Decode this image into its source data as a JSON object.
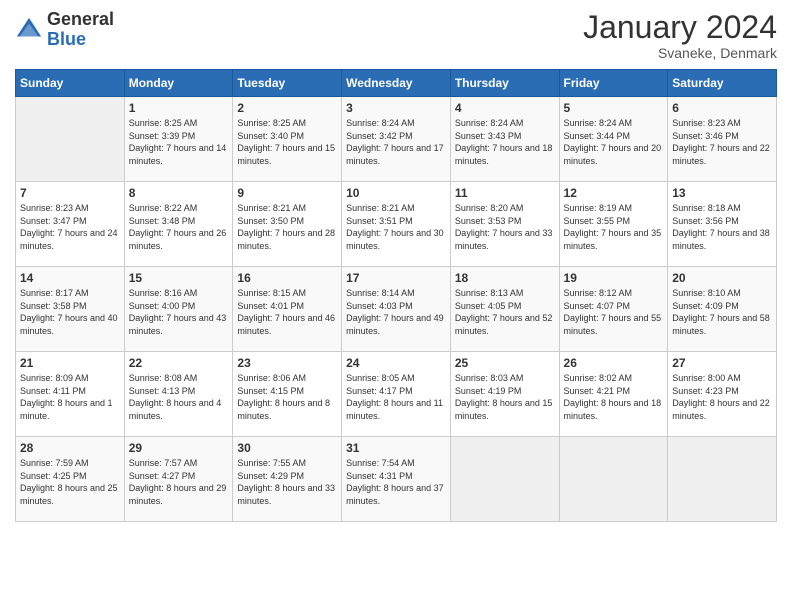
{
  "header": {
    "logo_general": "General",
    "logo_blue": "Blue",
    "month_title": "January 2024",
    "subtitle": "Svaneke, Denmark"
  },
  "days_of_week": [
    "Sunday",
    "Monday",
    "Tuesday",
    "Wednesday",
    "Thursday",
    "Friday",
    "Saturday"
  ],
  "weeks": [
    [
      {
        "day": "",
        "sunrise": "",
        "sunset": "",
        "daylight": ""
      },
      {
        "day": "1",
        "sunrise": "Sunrise: 8:25 AM",
        "sunset": "Sunset: 3:39 PM",
        "daylight": "Daylight: 7 hours and 14 minutes."
      },
      {
        "day": "2",
        "sunrise": "Sunrise: 8:25 AM",
        "sunset": "Sunset: 3:40 PM",
        "daylight": "Daylight: 7 hours and 15 minutes."
      },
      {
        "day": "3",
        "sunrise": "Sunrise: 8:24 AM",
        "sunset": "Sunset: 3:42 PM",
        "daylight": "Daylight: 7 hours and 17 minutes."
      },
      {
        "day": "4",
        "sunrise": "Sunrise: 8:24 AM",
        "sunset": "Sunset: 3:43 PM",
        "daylight": "Daylight: 7 hours and 18 minutes."
      },
      {
        "day": "5",
        "sunrise": "Sunrise: 8:24 AM",
        "sunset": "Sunset: 3:44 PM",
        "daylight": "Daylight: 7 hours and 20 minutes."
      },
      {
        "day": "6",
        "sunrise": "Sunrise: 8:23 AM",
        "sunset": "Sunset: 3:46 PM",
        "daylight": "Daylight: 7 hours and 22 minutes."
      }
    ],
    [
      {
        "day": "7",
        "sunrise": "Sunrise: 8:23 AM",
        "sunset": "Sunset: 3:47 PM",
        "daylight": "Daylight: 7 hours and 24 minutes."
      },
      {
        "day": "8",
        "sunrise": "Sunrise: 8:22 AM",
        "sunset": "Sunset: 3:48 PM",
        "daylight": "Daylight: 7 hours and 26 minutes."
      },
      {
        "day": "9",
        "sunrise": "Sunrise: 8:21 AM",
        "sunset": "Sunset: 3:50 PM",
        "daylight": "Daylight: 7 hours and 28 minutes."
      },
      {
        "day": "10",
        "sunrise": "Sunrise: 8:21 AM",
        "sunset": "Sunset: 3:51 PM",
        "daylight": "Daylight: 7 hours and 30 minutes."
      },
      {
        "day": "11",
        "sunrise": "Sunrise: 8:20 AM",
        "sunset": "Sunset: 3:53 PM",
        "daylight": "Daylight: 7 hours and 33 minutes."
      },
      {
        "day": "12",
        "sunrise": "Sunrise: 8:19 AM",
        "sunset": "Sunset: 3:55 PM",
        "daylight": "Daylight: 7 hours and 35 minutes."
      },
      {
        "day": "13",
        "sunrise": "Sunrise: 8:18 AM",
        "sunset": "Sunset: 3:56 PM",
        "daylight": "Daylight: 7 hours and 38 minutes."
      }
    ],
    [
      {
        "day": "14",
        "sunrise": "Sunrise: 8:17 AM",
        "sunset": "Sunset: 3:58 PM",
        "daylight": "Daylight: 7 hours and 40 minutes."
      },
      {
        "day": "15",
        "sunrise": "Sunrise: 8:16 AM",
        "sunset": "Sunset: 4:00 PM",
        "daylight": "Daylight: 7 hours and 43 minutes."
      },
      {
        "day": "16",
        "sunrise": "Sunrise: 8:15 AM",
        "sunset": "Sunset: 4:01 PM",
        "daylight": "Daylight: 7 hours and 46 minutes."
      },
      {
        "day": "17",
        "sunrise": "Sunrise: 8:14 AM",
        "sunset": "Sunset: 4:03 PM",
        "daylight": "Daylight: 7 hours and 49 minutes."
      },
      {
        "day": "18",
        "sunrise": "Sunrise: 8:13 AM",
        "sunset": "Sunset: 4:05 PM",
        "daylight": "Daylight: 7 hours and 52 minutes."
      },
      {
        "day": "19",
        "sunrise": "Sunrise: 8:12 AM",
        "sunset": "Sunset: 4:07 PM",
        "daylight": "Daylight: 7 hours and 55 minutes."
      },
      {
        "day": "20",
        "sunrise": "Sunrise: 8:10 AM",
        "sunset": "Sunset: 4:09 PM",
        "daylight": "Daylight: 7 hours and 58 minutes."
      }
    ],
    [
      {
        "day": "21",
        "sunrise": "Sunrise: 8:09 AM",
        "sunset": "Sunset: 4:11 PM",
        "daylight": "Daylight: 8 hours and 1 minute."
      },
      {
        "day": "22",
        "sunrise": "Sunrise: 8:08 AM",
        "sunset": "Sunset: 4:13 PM",
        "daylight": "Daylight: 8 hours and 4 minutes."
      },
      {
        "day": "23",
        "sunrise": "Sunrise: 8:06 AM",
        "sunset": "Sunset: 4:15 PM",
        "daylight": "Daylight: 8 hours and 8 minutes."
      },
      {
        "day": "24",
        "sunrise": "Sunrise: 8:05 AM",
        "sunset": "Sunset: 4:17 PM",
        "daylight": "Daylight: 8 hours and 11 minutes."
      },
      {
        "day": "25",
        "sunrise": "Sunrise: 8:03 AM",
        "sunset": "Sunset: 4:19 PM",
        "daylight": "Daylight: 8 hours and 15 minutes."
      },
      {
        "day": "26",
        "sunrise": "Sunrise: 8:02 AM",
        "sunset": "Sunset: 4:21 PM",
        "daylight": "Daylight: 8 hours and 18 minutes."
      },
      {
        "day": "27",
        "sunrise": "Sunrise: 8:00 AM",
        "sunset": "Sunset: 4:23 PM",
        "daylight": "Daylight: 8 hours and 22 minutes."
      }
    ],
    [
      {
        "day": "28",
        "sunrise": "Sunrise: 7:59 AM",
        "sunset": "Sunset: 4:25 PM",
        "daylight": "Daylight: 8 hours and 25 minutes."
      },
      {
        "day": "29",
        "sunrise": "Sunrise: 7:57 AM",
        "sunset": "Sunset: 4:27 PM",
        "daylight": "Daylight: 8 hours and 29 minutes."
      },
      {
        "day": "30",
        "sunrise": "Sunrise: 7:55 AM",
        "sunset": "Sunset: 4:29 PM",
        "daylight": "Daylight: 8 hours and 33 minutes."
      },
      {
        "day": "31",
        "sunrise": "Sunrise: 7:54 AM",
        "sunset": "Sunset: 4:31 PM",
        "daylight": "Daylight: 8 hours and 37 minutes."
      },
      {
        "day": "",
        "sunrise": "",
        "sunset": "",
        "daylight": ""
      },
      {
        "day": "",
        "sunrise": "",
        "sunset": "",
        "daylight": ""
      },
      {
        "day": "",
        "sunrise": "",
        "sunset": "",
        "daylight": ""
      }
    ]
  ]
}
